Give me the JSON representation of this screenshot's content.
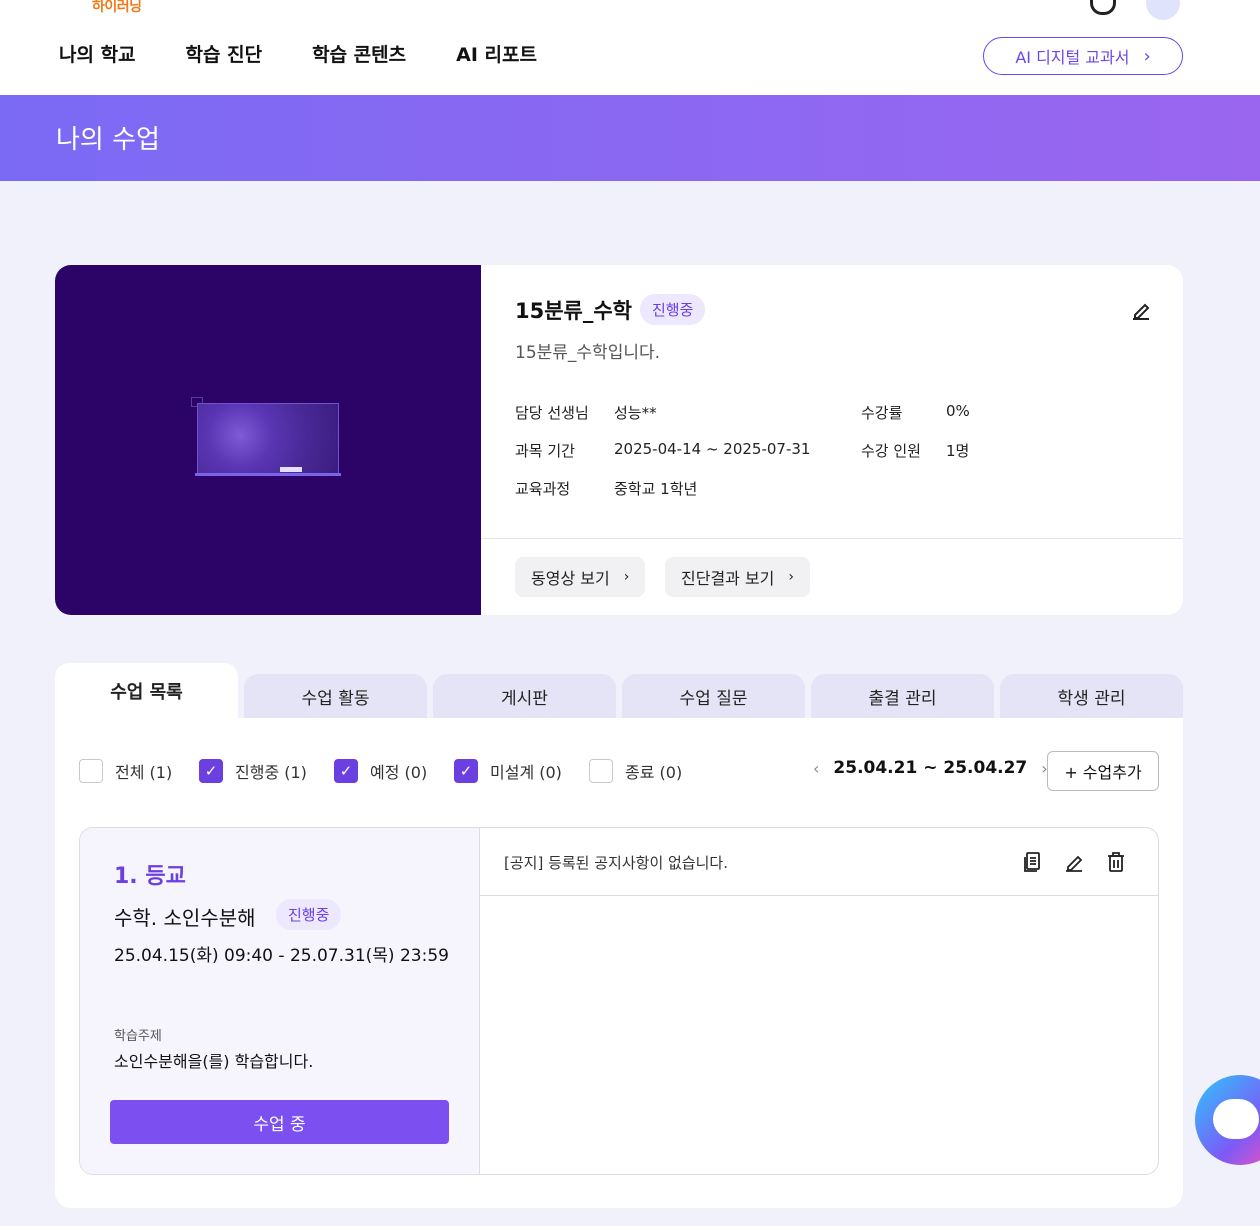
{
  "header": {
    "logo": "하이러닝",
    "nav": [
      "나의 학교",
      "학습 진단",
      "학습 콘텐츠",
      "AI 리포트"
    ],
    "ai_button": "AI 디지털 교과서"
  },
  "banner": {
    "title": "나의 수업"
  },
  "course": {
    "title": "15분류_수학",
    "status": "진행중",
    "description": "15분류_수학입니다.",
    "meta": {
      "teacher_label": "담당 선생님",
      "teacher": "성능**",
      "period_label": "과목 기간",
      "period": "2025-04-14 ~ 2025-07-31",
      "curriculum_label": "교육과정",
      "curriculum": "중학교 1학년",
      "completion_label": "수강률",
      "completion": "0%",
      "students_label": "수강 인원",
      "students": "1명"
    },
    "buttons": {
      "video": "동영상 보기",
      "diagnosis": "진단결과 보기"
    }
  },
  "tabs": [
    "수업 목록",
    "수업 활동",
    "게시판",
    "수업 질문",
    "출결 관리",
    "학생 관리"
  ],
  "filters": [
    {
      "label": "전체 (1)",
      "checked": false
    },
    {
      "label": "진행중 (1)",
      "checked": true
    },
    {
      "label": "예정 (0)",
      "checked": true
    },
    {
      "label": "미설계 (0)",
      "checked": true
    },
    {
      "label": "종료 (0)",
      "checked": false
    }
  ],
  "week": {
    "range": "25.04.21 ~ 25.04.27"
  },
  "add_button": "+ 수업추가",
  "lesson": {
    "number": "1. 등교",
    "title": "수학. 소인수분해",
    "status": "진행중",
    "time": "25.04.15(화) 09:40 - 25.07.31(목) 23:59",
    "topic_label": "학습주제",
    "topic": "소인수분해을(를) 학습합니다.",
    "button": "수업 중",
    "notice": "[공지] 등록된 공지사항이 없습니다."
  },
  "colors": {
    "accent": "#6b3fe0",
    "banner_start": "#7b6af4",
    "banner_end": "#9a66f0",
    "thumb_bg": "#2c0366"
  }
}
